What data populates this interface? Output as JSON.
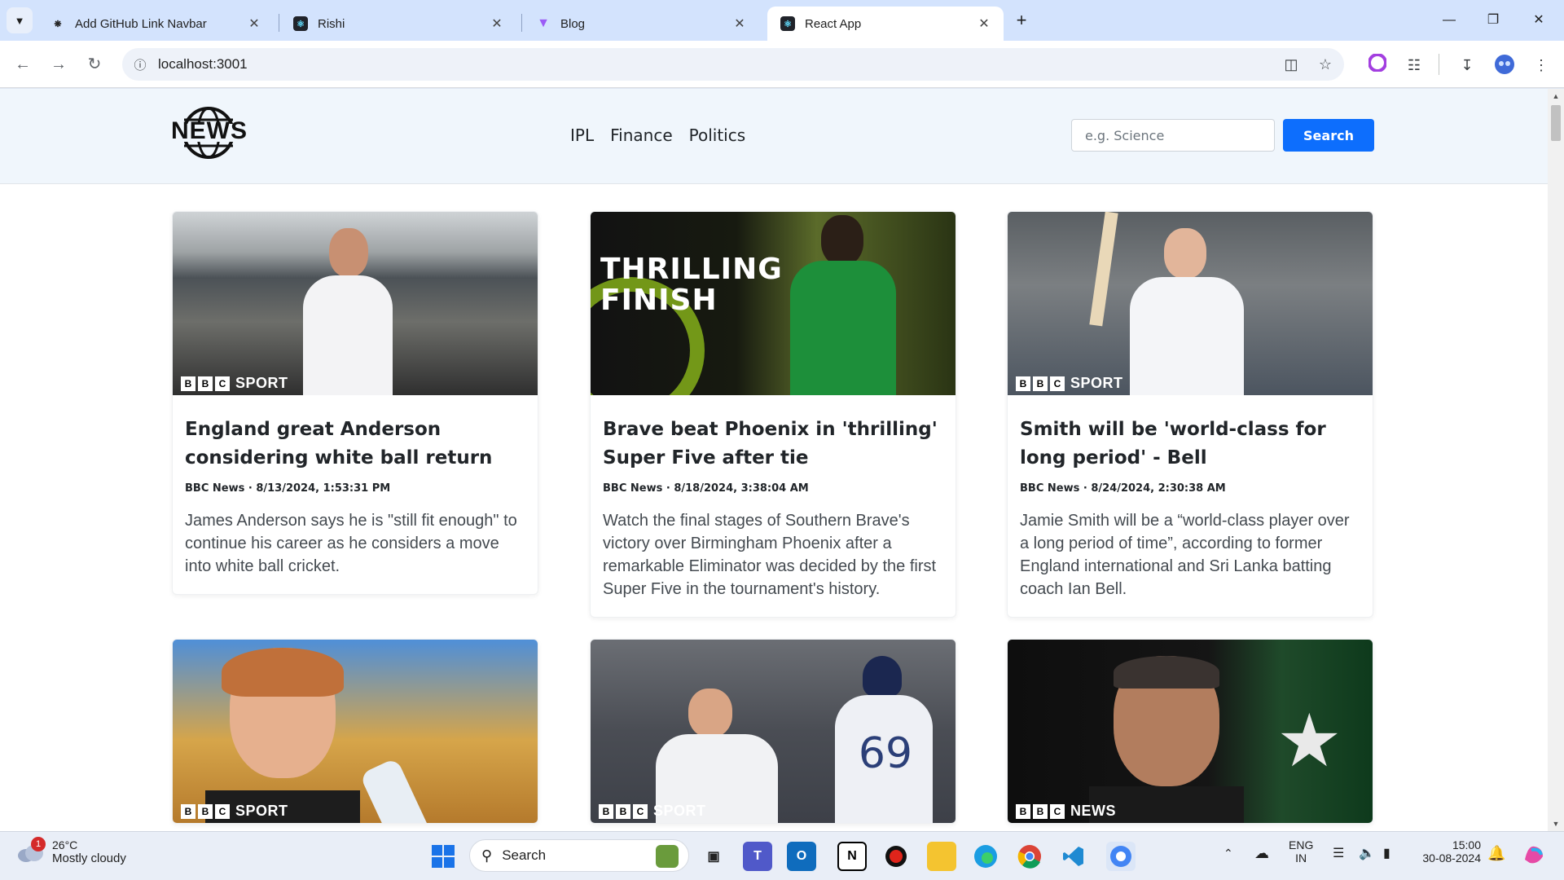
{
  "browser": {
    "tabs": [
      {
        "title": "Add GitHub Link Navbar",
        "active": false
      },
      {
        "title": "Rishi",
        "active": false
      },
      {
        "title": "Blog",
        "active": false
      },
      {
        "title": "React App",
        "active": true
      }
    ],
    "url": "localhost:3001"
  },
  "site": {
    "logo_text": "NEWS",
    "nav_links": [
      "IPL",
      "Finance",
      "Politics"
    ],
    "search_placeholder": "e.g. Science",
    "search_button": "Search"
  },
  "articles": [
    {
      "title": "England great Anderson considering white ball return",
      "meta": "BBC News · 8/13/2024, 1:53:31 PM",
      "description": "James Anderson says he is \"still fit enough\" to continue his career as he considers a move into white ball cricket.",
      "badge": "SPORT"
    },
    {
      "title": "Brave beat Phoenix in 'thrilling' Super Five after tie",
      "meta": "BBC News · 8/18/2024, 3:38:04 AM",
      "description": "Watch the final stages of Southern Brave's victory over Birmingham Phoenix after a remarkable Eliminator was decided by the first Super Five in the tournament's history.",
      "overlay": "THRILLING FINISH"
    },
    {
      "title": "Smith will be 'world-class for long period' - Bell",
      "meta": "BBC News · 8/24/2024, 2:30:38 AM",
      "description": "Jamie Smith will be a “world-class player over a long period of time”, according to former England international and Sri Lanka batting coach Ian Bell.",
      "badge": "SPORT"
    },
    {
      "badge": "SPORT"
    },
    {
      "badge": "SPORT",
      "shirt_number": "69"
    },
    {
      "badge": "NEWS"
    }
  ],
  "taskbar": {
    "notification_count": "1",
    "temperature": "26°C",
    "weather": "Mostly cloudy",
    "search_label": "Search",
    "lang_line1": "ENG",
    "lang_line2": "IN",
    "time": "15:00",
    "date": "30-08-2024"
  }
}
